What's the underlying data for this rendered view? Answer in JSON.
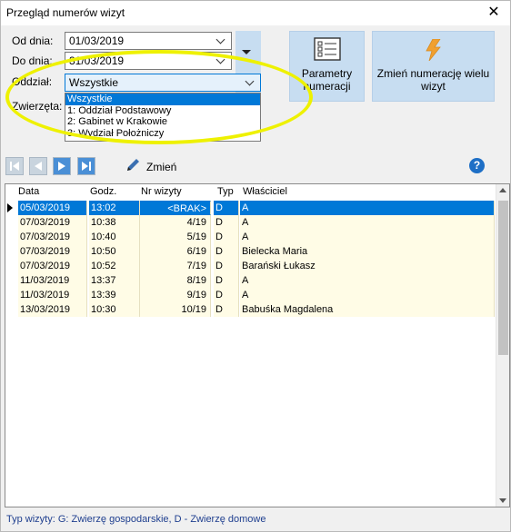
{
  "window": {
    "title": "Przegląd numerów wizyt",
    "close": "✕"
  },
  "filters": {
    "od_label": "Od dnia:",
    "od_value": "01/03/2019",
    "do_label": "Do dnia:",
    "do_value": "31/03/2019",
    "oddzial_label": "Oddział:",
    "oddzial_value": "Wszystkie",
    "zwierzeta_label": "Zwierzęta:",
    "dropdown_options": [
      "Wszystkie",
      "1: Oddział Podstawowy",
      "2: Gabinet w Krakowie",
      "3: Wydział Położniczy"
    ]
  },
  "buttons": {
    "parametry": "Parametry numeracji",
    "zmien_numeracje": "Zmień numerację wielu wizyt",
    "zmien": "Zmień",
    "help": "?"
  },
  "grid": {
    "headers": [
      "Data",
      "Godz.",
      "Nr wizyty",
      "Typ",
      "Właściciel"
    ],
    "rows": [
      [
        "05/03/2019",
        "13:02",
        "<BRAK>",
        "D",
        "A"
      ],
      [
        "07/03/2019",
        "10:38",
        "4/19",
        "D",
        "A"
      ],
      [
        "07/03/2019",
        "10:40",
        "5/19",
        "D",
        "A"
      ],
      [
        "07/03/2019",
        "10:50",
        "6/19",
        "D",
        "Bielecka Maria"
      ],
      [
        "07/03/2019",
        "10:52",
        "7/19",
        "D",
        "Barański Łukasz"
      ],
      [
        "11/03/2019",
        "13:37",
        "8/19",
        "D",
        "A"
      ],
      [
        "11/03/2019",
        "13:39",
        "9/19",
        "D",
        "A"
      ],
      [
        "13/03/2019",
        "10:30",
        "10/19",
        "D",
        "Babuśka  Magdalena"
      ]
    ]
  },
  "status": "Typ wizyty:  G: Zwierzę gospodarskie, D - Zwierzę domowe",
  "colors": {
    "selection": "#0078d7",
    "highlight_ring": "#eef100",
    "button_bg": "#c7ddf1"
  }
}
